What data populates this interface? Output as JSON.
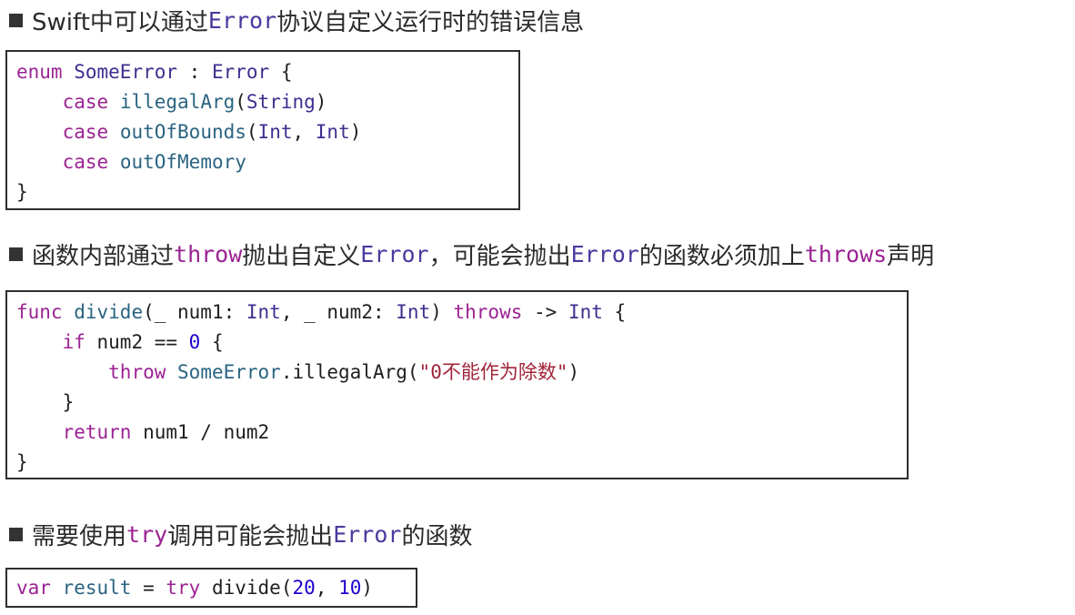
{
  "section1": {
    "pre": "Swift中可以通过",
    "kw": "Error",
    "post": "协议自定义运行时的错误信息"
  },
  "code1": {
    "l1": {
      "enum": "enum",
      "name": "SomeError",
      "colon": " : ",
      "proto": "Error",
      "brace": " {"
    },
    "l2": {
      "case": "case",
      "name": "illegalArg",
      "open": "(",
      "t1": "String",
      "close": ")"
    },
    "l3": {
      "case": "case",
      "name": "outOfBounds",
      "open": "(",
      "t1": "Int",
      "sep": ", ",
      "t2": "Int",
      "close": ")"
    },
    "l4": {
      "case": "case",
      "name": "outOfMemory"
    },
    "l5": "}"
  },
  "section2": {
    "pre": "函数内部通过",
    "kw1": "throw",
    "mid1": "抛出自定义",
    "kw2": "Error",
    "mid2": "，可能会抛出",
    "kw3": "Error",
    "mid3": "的函数必须加上",
    "kw4": "throws",
    "post": "声明"
  },
  "code2": {
    "l1": {
      "func": "func",
      "name": "divide",
      "p1": "(_ num1: ",
      "t1": "Int",
      "p2": ", _ num2: ",
      "t2": "Int",
      "p3": ") ",
      "throws": "throws",
      "arrow": " -> ",
      "t3": "Int",
      "brace": " {"
    },
    "l2": {
      "if": "if",
      "cond": " num2 == ",
      "zero": "0",
      "brace": " {"
    },
    "l3": {
      "throw": "throw",
      "type": "SomeError",
      "dot": ".illegalArg(",
      "str": "\"0不能作为除数\"",
      "close": ")"
    },
    "l4": "}",
    "l5": {
      "return": "return",
      "expr": " num1 / num2"
    },
    "l6": "}"
  },
  "section3": {
    "pre": "需要使用",
    "kw": "try",
    "mid": "调用可能会抛出",
    "kw2": "Error",
    "post": "的函数"
  },
  "code3": {
    "var": "var",
    "name": "result",
    "eq": " = ",
    "try": "try",
    "call": " divide(",
    "n1": "20",
    "sep": ", ",
    "n2": "10",
    "close": ")"
  }
}
